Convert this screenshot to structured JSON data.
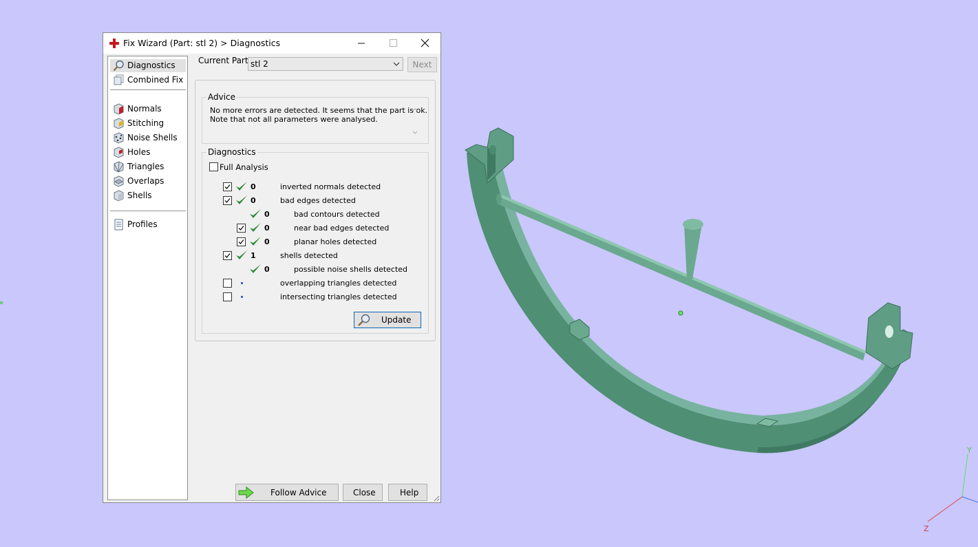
{
  "window": {
    "title": "Fix Wizard (Part: stl 2) > Diagnostics",
    "controls": [
      "minimize",
      "maximize",
      "close"
    ]
  },
  "nav": {
    "group1": [
      {
        "label": "Diagnostics",
        "icon": "magnifier-icon",
        "selected": true
      },
      {
        "label": "Combined Fix",
        "icon": "combined-fix-icon"
      }
    ],
    "group2": [
      {
        "label": "Normals",
        "icon": "normals-icon"
      },
      {
        "label": "Stitching",
        "icon": "stitching-icon"
      },
      {
        "label": "Noise Shells",
        "icon": "noise-shells-icon"
      },
      {
        "label": "Holes",
        "icon": "holes-icon"
      },
      {
        "label": "Triangles",
        "icon": "triangles-icon"
      },
      {
        "label": "Overlaps",
        "icon": "overlaps-icon"
      },
      {
        "label": "Shells",
        "icon": "shells-icon"
      }
    ],
    "group3": [
      {
        "label": "Profiles",
        "icon": "profiles-icon"
      }
    ]
  },
  "current_part": {
    "label": "Current Part:",
    "value": "stl 2",
    "next_label": "Next"
  },
  "advice": {
    "title": "Advice",
    "line1": "No more errors are detected. It seems that the part is ok.",
    "line2": "Note that not all parameters were analysed."
  },
  "diagnostics": {
    "title": "Diagnostics",
    "full_analysis_label": "Full Analysis",
    "full_analysis_checked": false,
    "rows": [
      {
        "checkbox": true,
        "checked": true,
        "status": "ok",
        "count": "0",
        "label": "inverted normals detected",
        "indent": 0
      },
      {
        "checkbox": true,
        "checked": true,
        "status": "ok",
        "count": "0",
        "label": "bad edges detected",
        "indent": 0
      },
      {
        "checkbox": false,
        "checked": false,
        "status": "ok",
        "count": "0",
        "label": "bad contours detected",
        "indent": 1
      },
      {
        "checkbox": true,
        "checked": true,
        "status": "ok",
        "count": "0",
        "label": "near bad edges detected",
        "indent": 1
      },
      {
        "checkbox": true,
        "checked": true,
        "status": "ok",
        "count": "0",
        "label": "planar holes detected",
        "indent": 1
      },
      {
        "checkbox": true,
        "checked": true,
        "status": "ok",
        "count": "1",
        "label": "shells detected",
        "indent": 0
      },
      {
        "checkbox": false,
        "checked": false,
        "status": "ok",
        "count": "0",
        "label": "possible noise shells detected",
        "indent": 1
      },
      {
        "checkbox": true,
        "checked": false,
        "status": "none",
        "count": "",
        "label": "overlapping triangles detected",
        "indent": 0
      },
      {
        "checkbox": true,
        "checked": false,
        "status": "none",
        "count": "",
        "label": "intersecting triangles detected",
        "indent": 0
      }
    ],
    "update_label": "Update"
  },
  "buttons": {
    "follow_advice": "Follow Advice",
    "close": "Close",
    "help": "Help"
  },
  "viewport": {
    "background": "#c9c7fb",
    "part_color": "#5f9e84",
    "axis_labels": {
      "y": "Y",
      "z": "Z",
      "x": "x"
    }
  }
}
